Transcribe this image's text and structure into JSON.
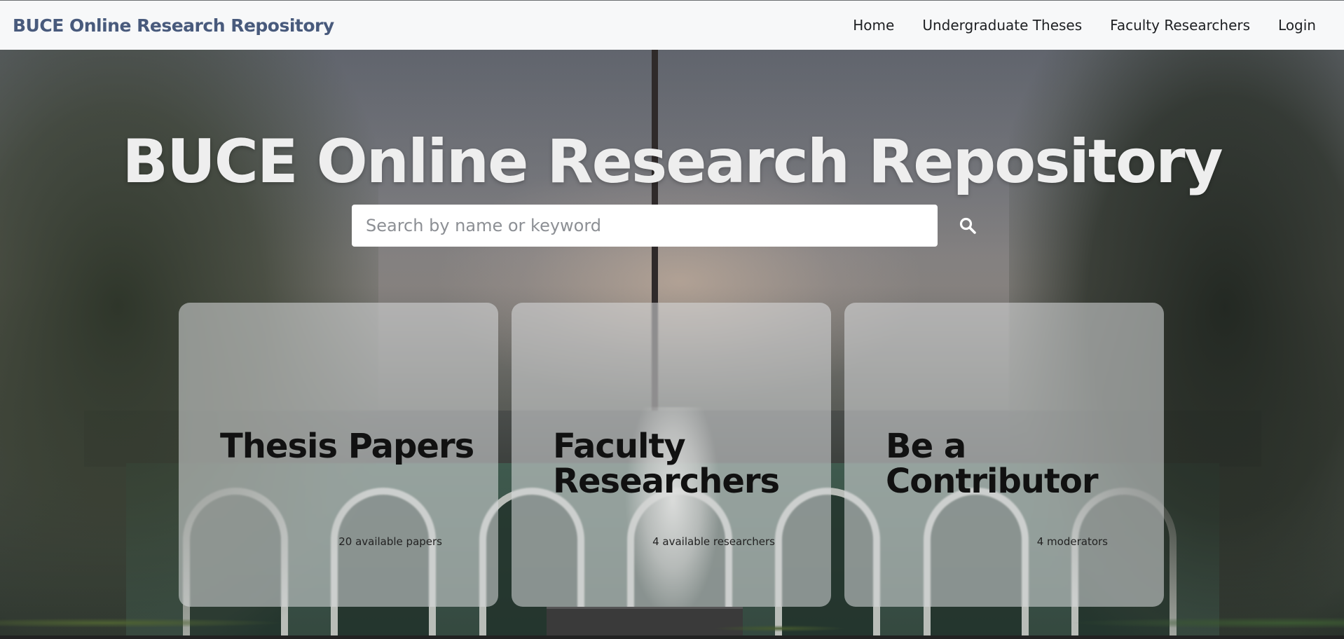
{
  "navbar": {
    "brand": "BUCE Online Research Repository",
    "links": [
      {
        "label": "Home"
      },
      {
        "label": "Undergraduate Theses"
      },
      {
        "label": "Faculty Researchers"
      },
      {
        "label": "Login"
      }
    ]
  },
  "hero": {
    "title": "BUCE Online Research Repository",
    "search": {
      "placeholder": "Search by name or keyword",
      "value": "",
      "button_icon": "search-icon"
    }
  },
  "cards": [
    {
      "title": "Thesis Papers",
      "meta": "20 available papers"
    },
    {
      "title": "Faculty Researchers",
      "meta": "4 available researchers"
    },
    {
      "title": "Be a Contributor",
      "meta": "4 moderators"
    }
  ],
  "colors": {
    "navbar_bg": "#f7f8f9",
    "brand": "#485a7c",
    "card_bg": "rgba(220,222,224,0.55)",
    "title_text": "#eeeeee"
  }
}
